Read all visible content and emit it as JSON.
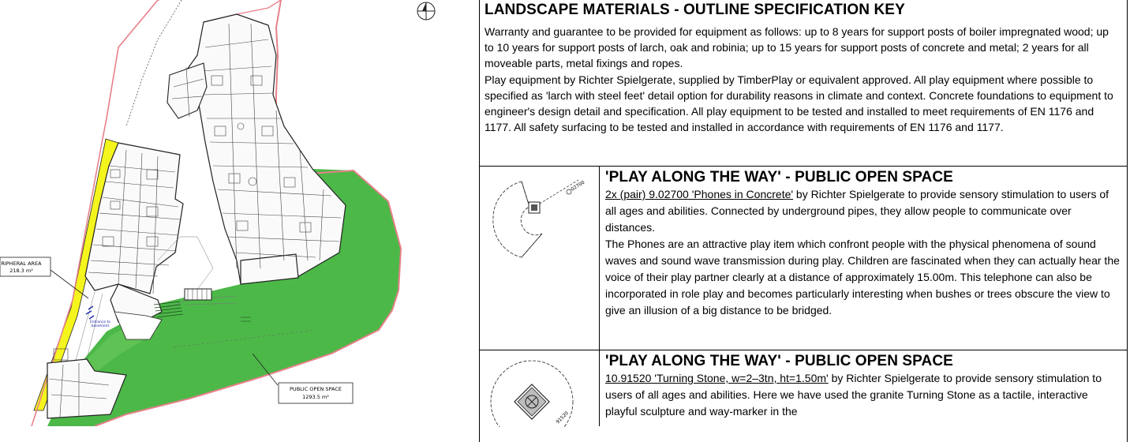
{
  "plan": {
    "peripheral_area": {
      "name": "RIPHERAL AREA",
      "area": "218.3 m²"
    },
    "public_open_space": {
      "name": "PUBLIC OPEN SPACE",
      "area": "1293.5 m²"
    },
    "entrance_label": "Entrance to basement",
    "colors": {
      "boundary": "#e8808a",
      "green": "#4cb848",
      "yellow": "#f5f51e",
      "lines": "#222222"
    }
  },
  "spec": {
    "title": "LANDSCAPE MATERIALS - OUTLINE SPECIFICATION KEY",
    "intro": [
      "Warranty and guarantee to be provided for equipment as follows: up to 8 years for support posts of boiler impregnated wood; up to 10 years for support posts of larch, oak and robinia; up to 15 years for support posts of concrete and metal; 2 years for all moveable parts, metal fixings and ropes.",
      "Play equipment by Richter Spielgerate, supplied by TimberPlay or equivalent approved. All play equipment where possible to specified as 'larch with steel feet' detail option for durability reasons in climate and context. Concrete foundations to equipment to engineer's design detail and specification. All play equipment to be tested and installed to meet requirements of EN 1176 and 1177. All safety surfacing to be tested and installed in accordance with requirements of EN 1176 and 1177."
    ],
    "items": [
      {
        "heading": "'PLAY ALONG THE WAY' - PUBLIC OPEN SPACE",
        "product": "2x (pair) 9.02700 'Phones in Concrete'",
        "lead": " by Richter Spielgerate to provide sensory stimulation to users of all ages and abilities. Connected by underground pipes, they allow people to communicate over distances.",
        "body": "The Phones are an attractive play item which confront people with the physical phenomena of sound waves and sound wave transmission during play. Children are fascinated when they can actually hear the voice of their play partner clearly at a distance of approximately 15.00m. This telephone can also be incorporated in role play and becomes particularly interesting when bushes or trees obscure the view to give an illusion of a big distance to be bridged.",
        "thumb_code": "02700"
      },
      {
        "heading": "'PLAY ALONG THE WAY' - PUBLIC OPEN SPACE",
        "product": "10.91520 'Turning Stone, w=2–3tn, ht=1.50m'",
        "lead": " by Richter Spielgerate to provide sensory stimulation to users of all ages and abilities. Here we have used the granite Turning Stone as a tactile, interactive playful sculpture and way-marker in the",
        "thumb_code": "91520"
      }
    ]
  }
}
